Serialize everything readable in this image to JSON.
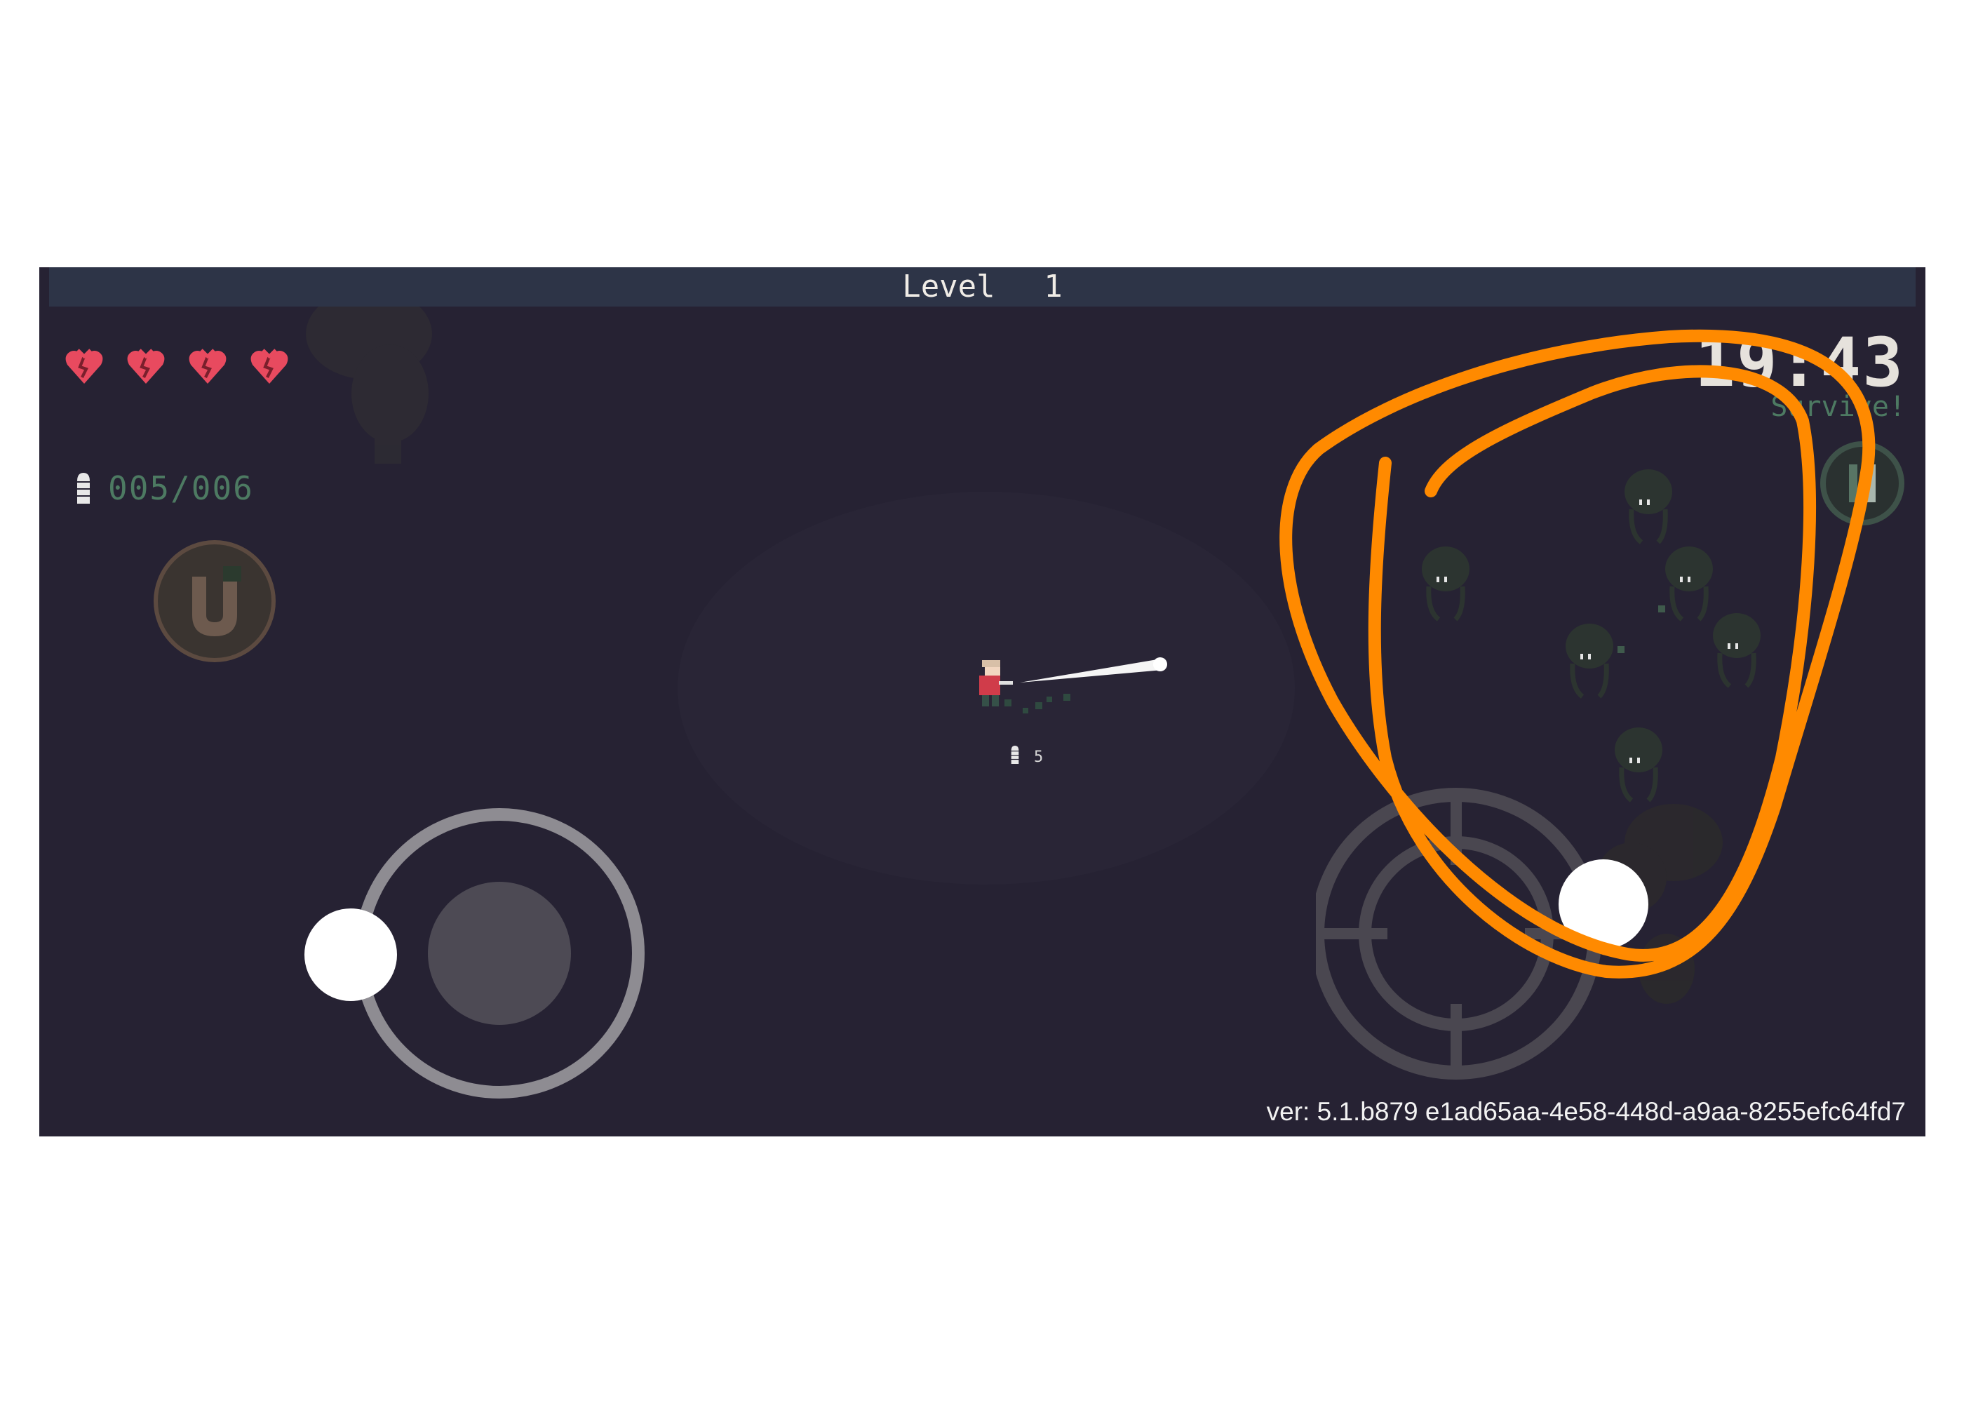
{
  "hud": {
    "level_label": "Level",
    "level_value": "1",
    "hearts": 4,
    "ammo": "005/006",
    "timer": "19:43",
    "objective": "Survive!",
    "pickup_count": "5",
    "version": "ver: 5.1.b879 e1ad65aa-4e58-448d-a9aa-8255efc64fd7"
  },
  "icons": {
    "heart": "heart-icon",
    "ammo": "bullet-icon",
    "magnet": "magnet-icon",
    "pause": "pause-icon",
    "crosshair": "crosshair-icon"
  },
  "colors": {
    "background": "#262233",
    "level_bar": "#2d3447",
    "heart": "#e84a5f",
    "annotation": "#ff8a00",
    "ui_green": "#4d7a62"
  }
}
